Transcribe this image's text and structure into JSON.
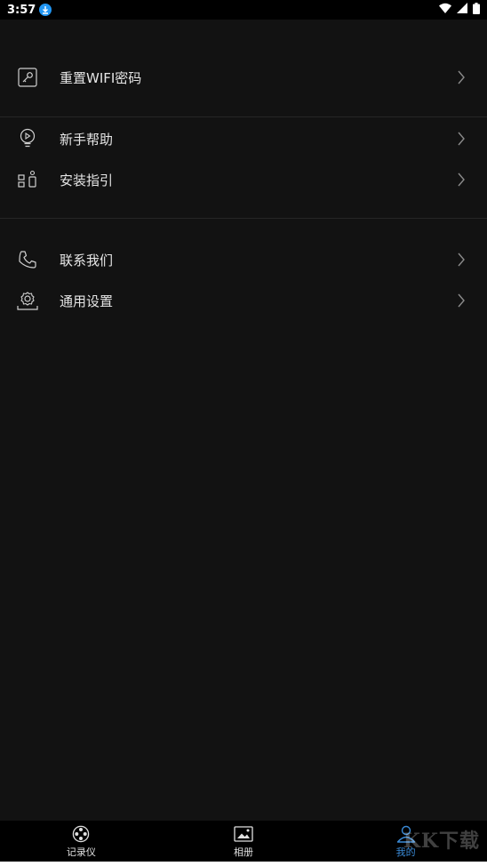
{
  "status_bar": {
    "time": "3:57"
  },
  "menu": {
    "reset_wifi": "重置WIFI密码",
    "help": "新手帮助",
    "install_guide": "安装指引",
    "contact": "联系我们",
    "settings": "通用设置"
  },
  "bottom_nav": {
    "recorder": "记录仪",
    "album": "相册",
    "mine": "我的"
  },
  "watermark": "KK下载",
  "colors": {
    "background": "#121212",
    "accent": "#3a8ad6"
  }
}
